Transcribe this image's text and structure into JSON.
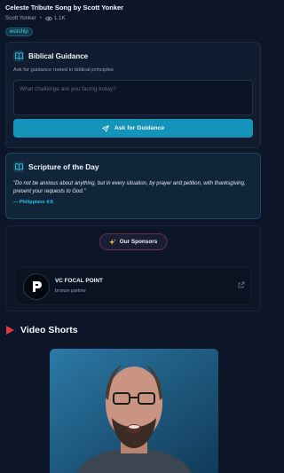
{
  "video": {
    "title": "Celeste Tribute Song by Scott Yonker",
    "author": "Scott Yonker",
    "views": "1.1K",
    "tag": "worship"
  },
  "guidance": {
    "title": "Biblical Guidance",
    "subtitle": "Ask for guidance rooted in biblical principles",
    "placeholder": "What challenge are you facing today?",
    "button_label": "Ask for Guidance"
  },
  "scripture": {
    "title": "Scripture of the Day",
    "verse": "\"Do not be anxious about anything, but in every situation, by prayer and petition, with thanksgiving, present your requests to God.\"",
    "reference": "— Philippians 4:6"
  },
  "sponsors": {
    "badge_label": "Our Sponsors",
    "items": [
      {
        "name": "VC FOCAL POINT",
        "tier": "bronze partner"
      }
    ]
  },
  "shorts": {
    "title": "Video Shorts"
  },
  "colors": {
    "accent": "#1394b8",
    "background": "#0d1628",
    "shorts_icon": "#e0393e"
  },
  "icons": [
    "eye-icon",
    "book-icon",
    "send-icon",
    "sparkle-icon",
    "external-link-icon",
    "play-icon"
  ]
}
